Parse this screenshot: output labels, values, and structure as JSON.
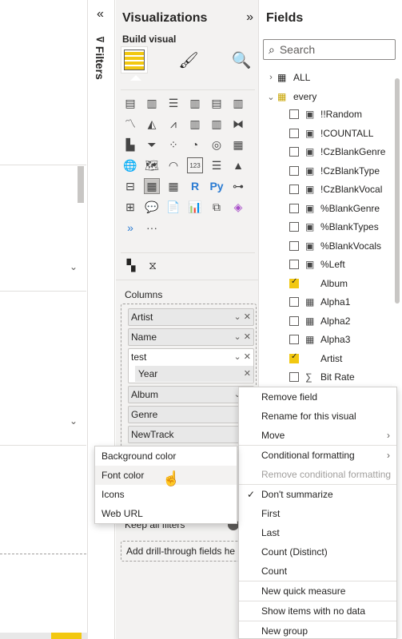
{
  "filters_pane": {
    "label": "Filters"
  },
  "visualizations": {
    "title": "Visualizations",
    "build_label": "Build visual",
    "columns_label": "Columns",
    "column_pills": [
      "Artist",
      "Name",
      "test",
      "Album",
      "Genre",
      "NewTrack"
    ],
    "group_sub": "Year",
    "keep_filters": "Keep all filters",
    "drill_placeholder": "Add drill-through fields he",
    "viz_icons": [
      "stacked-bar-icon",
      "stacked-column-icon",
      "clustered-bar-icon",
      "clustered-column-icon",
      "100-bar-icon",
      "100-column-icon",
      "line-icon",
      "area-icon",
      "stacked-area-icon",
      "line-column-icon",
      "line-cluster-icon",
      "ribbon-icon",
      "waterfall-icon",
      "funnel-icon",
      "scatter-icon",
      "pie-icon",
      "donut-icon",
      "treemap-icon",
      "map-icon",
      "filled-map-icon",
      "gauge-icon",
      "card-icon",
      "multirow-card-icon",
      "kpi-icon",
      "slicer-icon",
      "table-icon",
      "matrix-icon",
      "r-icon",
      "python-icon",
      "key-influencers-icon",
      "decomposition-icon",
      "qa-icon",
      "narrative-icon",
      "paginated-icon",
      "power-apps-icon",
      "power-automate-icon",
      "smart-narrative-icon",
      "more-icon"
    ],
    "r_glyph": "R",
    "py_glyph": "Py",
    "more_glyph": "···",
    "card_glyph": "123"
  },
  "fields": {
    "title": "Fields",
    "search_placeholder": "Search",
    "tables": [
      {
        "name": "ALL",
        "expanded": false
      },
      {
        "name": "every",
        "expanded": true
      }
    ],
    "items": [
      {
        "name": "!!Random",
        "checked": false,
        "icon": "calculator-icon"
      },
      {
        "name": "!COUNTALL",
        "checked": false,
        "icon": "calculator-icon"
      },
      {
        "name": "!CzBlankGenre",
        "checked": false,
        "icon": "calculator-icon"
      },
      {
        "name": "!CzBlankType",
        "checked": false,
        "icon": "calculator-icon"
      },
      {
        "name": "!CzBlankVocal",
        "checked": false,
        "icon": "calculator-icon"
      },
      {
        "name": "%BlankGenre",
        "checked": false,
        "icon": "calculator-icon"
      },
      {
        "name": "%BlankTypes",
        "checked": false,
        "icon": "calculator-icon"
      },
      {
        "name": "%BlankVocals",
        "checked": false,
        "icon": "calculator-icon"
      },
      {
        "name": "%Left",
        "checked": false,
        "icon": "calculator-icon"
      },
      {
        "name": "Album",
        "checked": true,
        "icon": ""
      },
      {
        "name": "Alpha1",
        "checked": false,
        "icon": "calc-column-icon"
      },
      {
        "name": "Alpha2",
        "checked": false,
        "icon": "calc-column-icon"
      },
      {
        "name": "Alpha3",
        "checked": false,
        "icon": "calc-column-icon"
      },
      {
        "name": "Artist",
        "checked": true,
        "icon": ""
      },
      {
        "name": "Bit Rate",
        "checked": false,
        "icon": "sigma-icon"
      }
    ]
  },
  "context_menu": {
    "items": [
      "Remove field",
      "Rename for this visual",
      "Move",
      "Conditional formatting",
      "Remove conditional formatting",
      "Don't summarize",
      "First",
      "Last",
      "Count (Distinct)",
      "Count",
      "New quick measure",
      "Show items with no data",
      "New group"
    ]
  },
  "submenu": {
    "items": [
      "Background color",
      "Font color",
      "Icons",
      "Web URL"
    ]
  }
}
